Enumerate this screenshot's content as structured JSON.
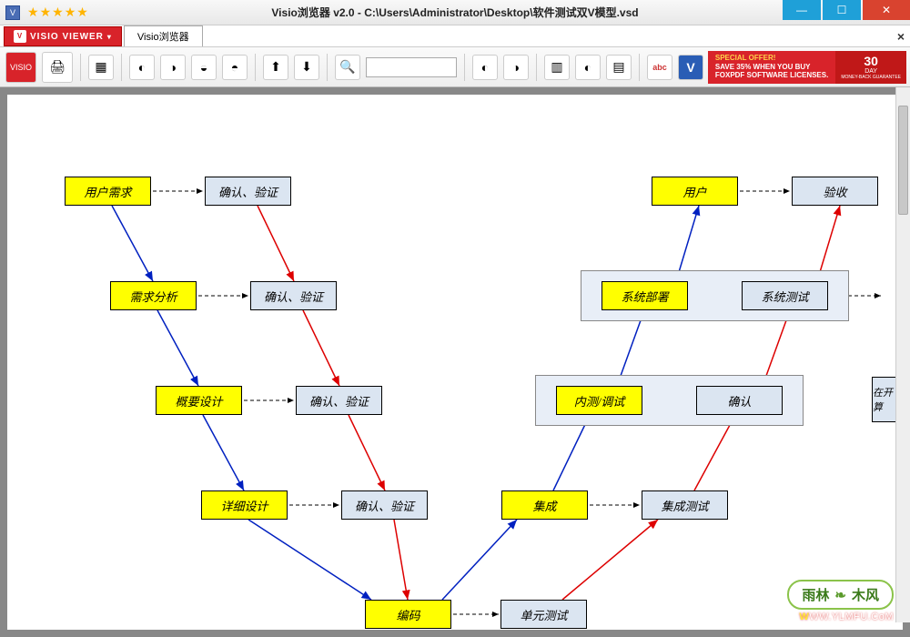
{
  "window": {
    "title": "Visio浏览器 v2.0 - C:\\Users\\Administrator\\Desktop\\软件测试双V模型.vsd",
    "app_icon": "V",
    "stars": 5
  },
  "tabs": {
    "brand": "VISIO VIEWER",
    "active": "Visio浏览器",
    "close": "×"
  },
  "toolbar": {
    "open_icon": "📁",
    "print_icon": "🖨",
    "view_icon": "▦",
    "chart1": "◐",
    "chart2": "◑",
    "chart3": "◒",
    "chart4": "◓",
    "up_icon": "▲",
    "down_icon": "▼",
    "search_icon": "🔍",
    "zoom_value": "",
    "t1": "◐",
    "t2": "◑",
    "t3": "▥",
    "t4": "◐",
    "t5": "▤",
    "abc": "abc",
    "v_icon": "V"
  },
  "ad": {
    "line1": "SPECIAL OFFER!",
    "line2": "SAVE 35% WHEN YOU BUY",
    "line3": "FOXPDF SOFTWARE LICENSES.",
    "badge_top": "30",
    "badge_mid": "DAY",
    "badge_bot": "MONEY-BACK GUARANTEE"
  },
  "diagram": {
    "nodes": {
      "n1": "用户需求",
      "n1v": "确认、验证",
      "n2": "需求分析",
      "n2v": "确认、验证",
      "n3": "概要设计",
      "n3v": "确认、验证",
      "n4": "详细设计",
      "n4v": "确认、验证",
      "n5": "编码",
      "n5u": "单元测试",
      "r1": "用户",
      "r1v": "验收",
      "r2": "系统部署",
      "r2v": "系统测试",
      "r3": "内测/调试",
      "r3v": "确认",
      "r4": "集成",
      "r4v": "集成测试",
      "rx": "在开\n定算"
    }
  },
  "watermark": {
    "brand_left": "雨林",
    "brand_right": "木风",
    "url": "WW.YLMFU.CoM",
    "url_prefix": "W"
  }
}
